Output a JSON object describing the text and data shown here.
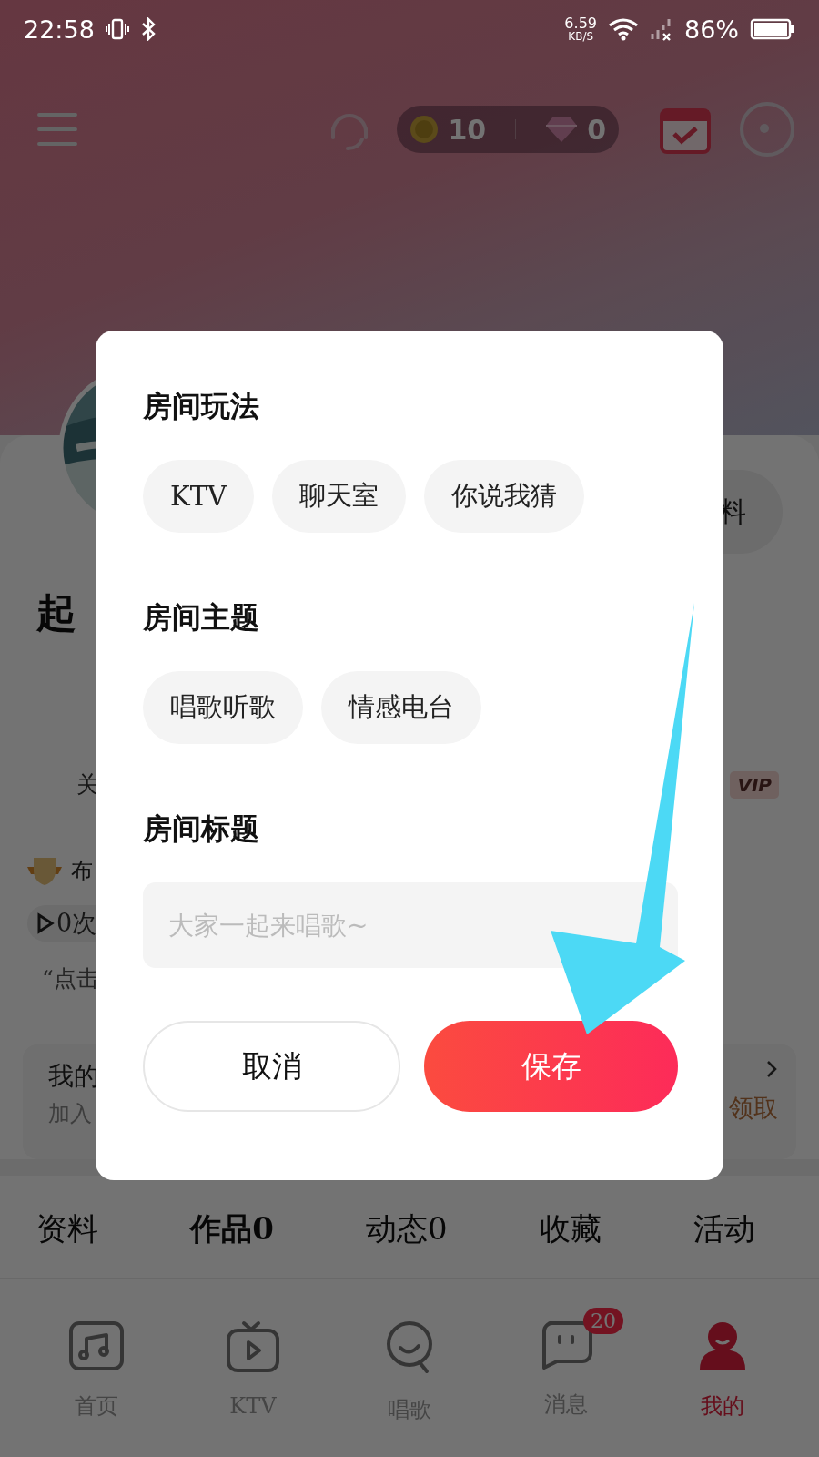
{
  "status_bar": {
    "time": "22:58",
    "speed": "6.59",
    "speed_unit": "KB/S",
    "battery": "86%"
  },
  "toolbar": {
    "coins": "10",
    "diamonds": "0"
  },
  "profile": {
    "edit_button": "料",
    "name": "起",
    "stat_label": "关",
    "vip_badge": "VIP",
    "medal_text": "布",
    "plays": "0次",
    "quote": "“点击"
  },
  "promo_card": {
    "title": "我的",
    "subtitle": "加入",
    "action": "领取"
  },
  "profile_tabs": [
    {
      "label": "资料",
      "selected": false
    },
    {
      "label": "作品0",
      "selected": true
    },
    {
      "label": "动态0",
      "selected": false
    },
    {
      "label": "收藏",
      "selected": false
    },
    {
      "label": "活动",
      "selected": false
    }
  ],
  "bottom_nav": [
    {
      "kind": "home",
      "label": "首页",
      "selected": false
    },
    {
      "kind": "ktv",
      "label": "KTV",
      "selected": false
    },
    {
      "kind": "sing",
      "label": "唱歌",
      "selected": false
    },
    {
      "kind": "messages",
      "label": "消息",
      "selected": false,
      "badge": "20"
    },
    {
      "kind": "me",
      "label": "我的",
      "selected": true
    }
  ],
  "dialog": {
    "sections": [
      {
        "title": "房间玩法",
        "kind": "chips",
        "chips": [
          {
            "label": "KTV",
            "selected": false
          },
          {
            "label": "聊天室",
            "selected": false
          },
          {
            "label": "你说我猜",
            "selected": false
          }
        ]
      },
      {
        "title": "房间主题",
        "kind": "chips",
        "chips": [
          {
            "label": "唱歌听歌",
            "selected": false
          },
          {
            "label": "情感电台",
            "selected": false
          }
        ]
      },
      {
        "title": "房间标题",
        "kind": "input",
        "placeholder": "大家一起来唱歌~"
      }
    ],
    "cancel": "取消",
    "save": "保存"
  }
}
